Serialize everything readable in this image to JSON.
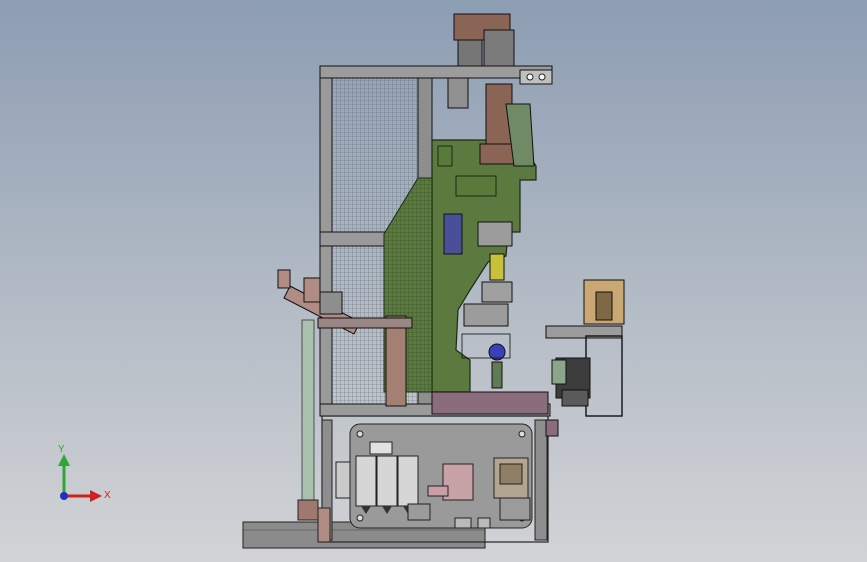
{
  "triad": {
    "y_label": "Y",
    "x_label": "X"
  },
  "colors": {
    "background_top": "#8d9db3",
    "background_bottom": "#d2d3d6",
    "frame_green": "#5c7a3f",
    "frame_edge": "#1b2a14",
    "steel_grey": "#8e8e8e",
    "motor_brown": "#8a6455",
    "base_mauve": "#8a6c7c",
    "pneumatic_blue": "#3a40b8",
    "spring_yellow": "#c8c23a",
    "axis_y": "#2fa63a",
    "axis_x": "#d02020",
    "axis_z": "#2030c0"
  }
}
